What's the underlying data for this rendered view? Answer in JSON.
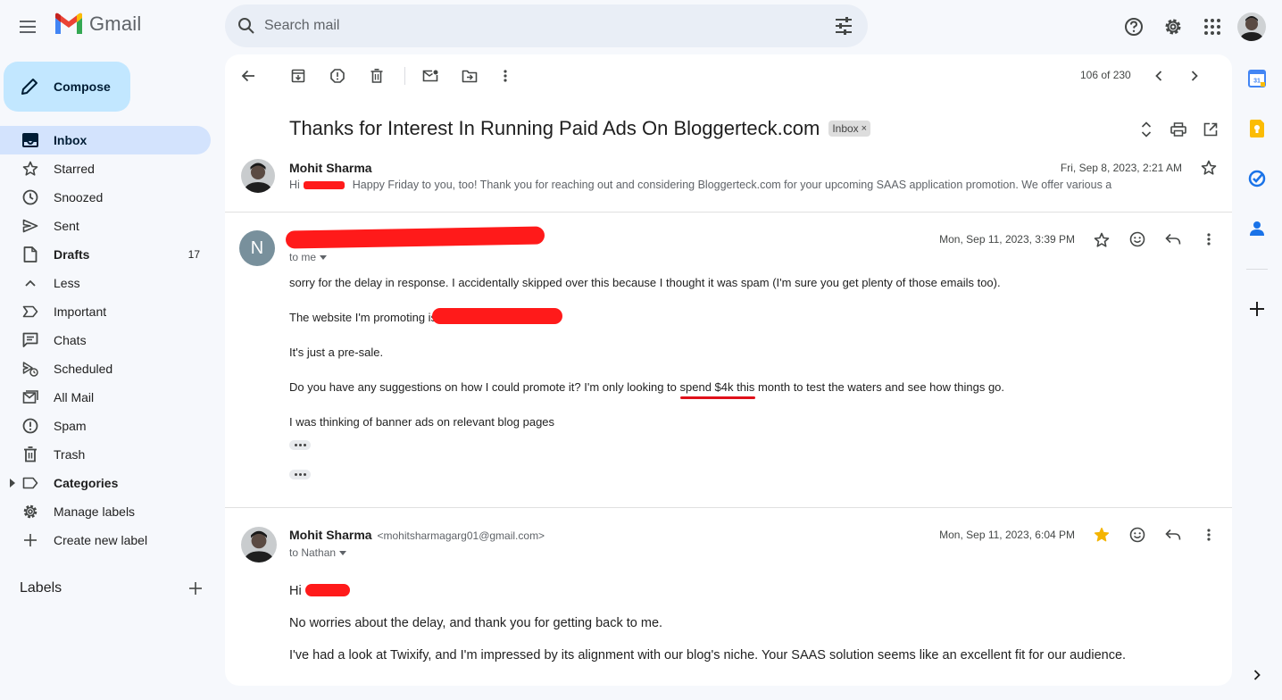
{
  "app": {
    "name": "Gmail",
    "search_placeholder": "Search mail"
  },
  "compose": {
    "label": "Compose"
  },
  "nav": {
    "items": [
      {
        "label": "Inbox",
        "icon": "inbox-icon",
        "count": "",
        "active": true
      },
      {
        "label": "Starred",
        "icon": "star-icon",
        "count": ""
      },
      {
        "label": "Snoozed",
        "icon": "clock-icon",
        "count": ""
      },
      {
        "label": "Sent",
        "icon": "send-icon",
        "count": ""
      },
      {
        "label": "Drafts",
        "icon": "draft-icon",
        "count": "17"
      },
      {
        "label": "Less",
        "icon": "chevron-up-icon",
        "count": ""
      },
      {
        "label": "Important",
        "icon": "important-icon",
        "count": ""
      },
      {
        "label": "Chats",
        "icon": "chat-icon",
        "count": ""
      },
      {
        "label": "Scheduled",
        "icon": "scheduled-icon",
        "count": ""
      },
      {
        "label": "All Mail",
        "icon": "all-mail-icon",
        "count": ""
      },
      {
        "label": "Spam",
        "icon": "spam-icon",
        "count": ""
      },
      {
        "label": "Trash",
        "icon": "trash-icon",
        "count": ""
      },
      {
        "label": "Categories",
        "icon": "label-icon",
        "count": ""
      },
      {
        "label": "Manage labels",
        "icon": "gear-icon",
        "count": ""
      },
      {
        "label": "Create new label",
        "icon": "plus-icon",
        "count": ""
      }
    ],
    "labels_header": "Labels"
  },
  "toolbar": {
    "pager": "106 of 230"
  },
  "thread": {
    "subject": "Thanks for Interest In Running Paid Ads On Bloggerteck.com",
    "chip": "Inbox",
    "chip_close": "×",
    "messages": [
      {
        "sender": "Mohit Sharma",
        "date": "Fri, Sep 8, 2023, 2:21 AM",
        "snippet_prefix": "Hi",
        "snippet": "Happy Friday to you, too! Thank you for reaching out and considering Bloggerteck.com for your upcoming SAAS application promotion. We offer various a"
      },
      {
        "avatar_letter": "N",
        "date": "Mon, Sep 11, 2023, 3:39 PM",
        "to": "to me",
        "body": [
          "sorry for the delay in response. I accidentally skipped over this because I thought it was spam (I'm sure you get plenty of those emails too).",
          "The website I'm promoting is",
          "It's just a pre-sale.",
          "Do you have any suggestions on how I could promote it? I'm only looking to spend $4k this month to test the waters and see how things go.",
          "I was thinking of banner ads on relevant blog pages"
        ]
      },
      {
        "sender": "Mohit Sharma",
        "email": "<mohitsharmagarg01@gmail.com>",
        "date": "Mon, Sep 11, 2023, 6:04 PM",
        "to": "to Nathan",
        "starred": true,
        "body": [
          "Hi",
          "No worries about the delay, and thank you for getting back to me.",
          "I've had a look at Twixify, and I'm impressed by its alignment with our blog's niche. Your SAAS solution seems like an excellent fit for our audience."
        ]
      }
    ]
  },
  "colors": {
    "compose_bg": "#c2e7ff",
    "active_nav_bg": "#d3e3fd",
    "search_bg": "#e9eef6",
    "redaction": "#ff1a1a",
    "star_active": "#f4b400",
    "page_bg": "#f6f8fc"
  }
}
